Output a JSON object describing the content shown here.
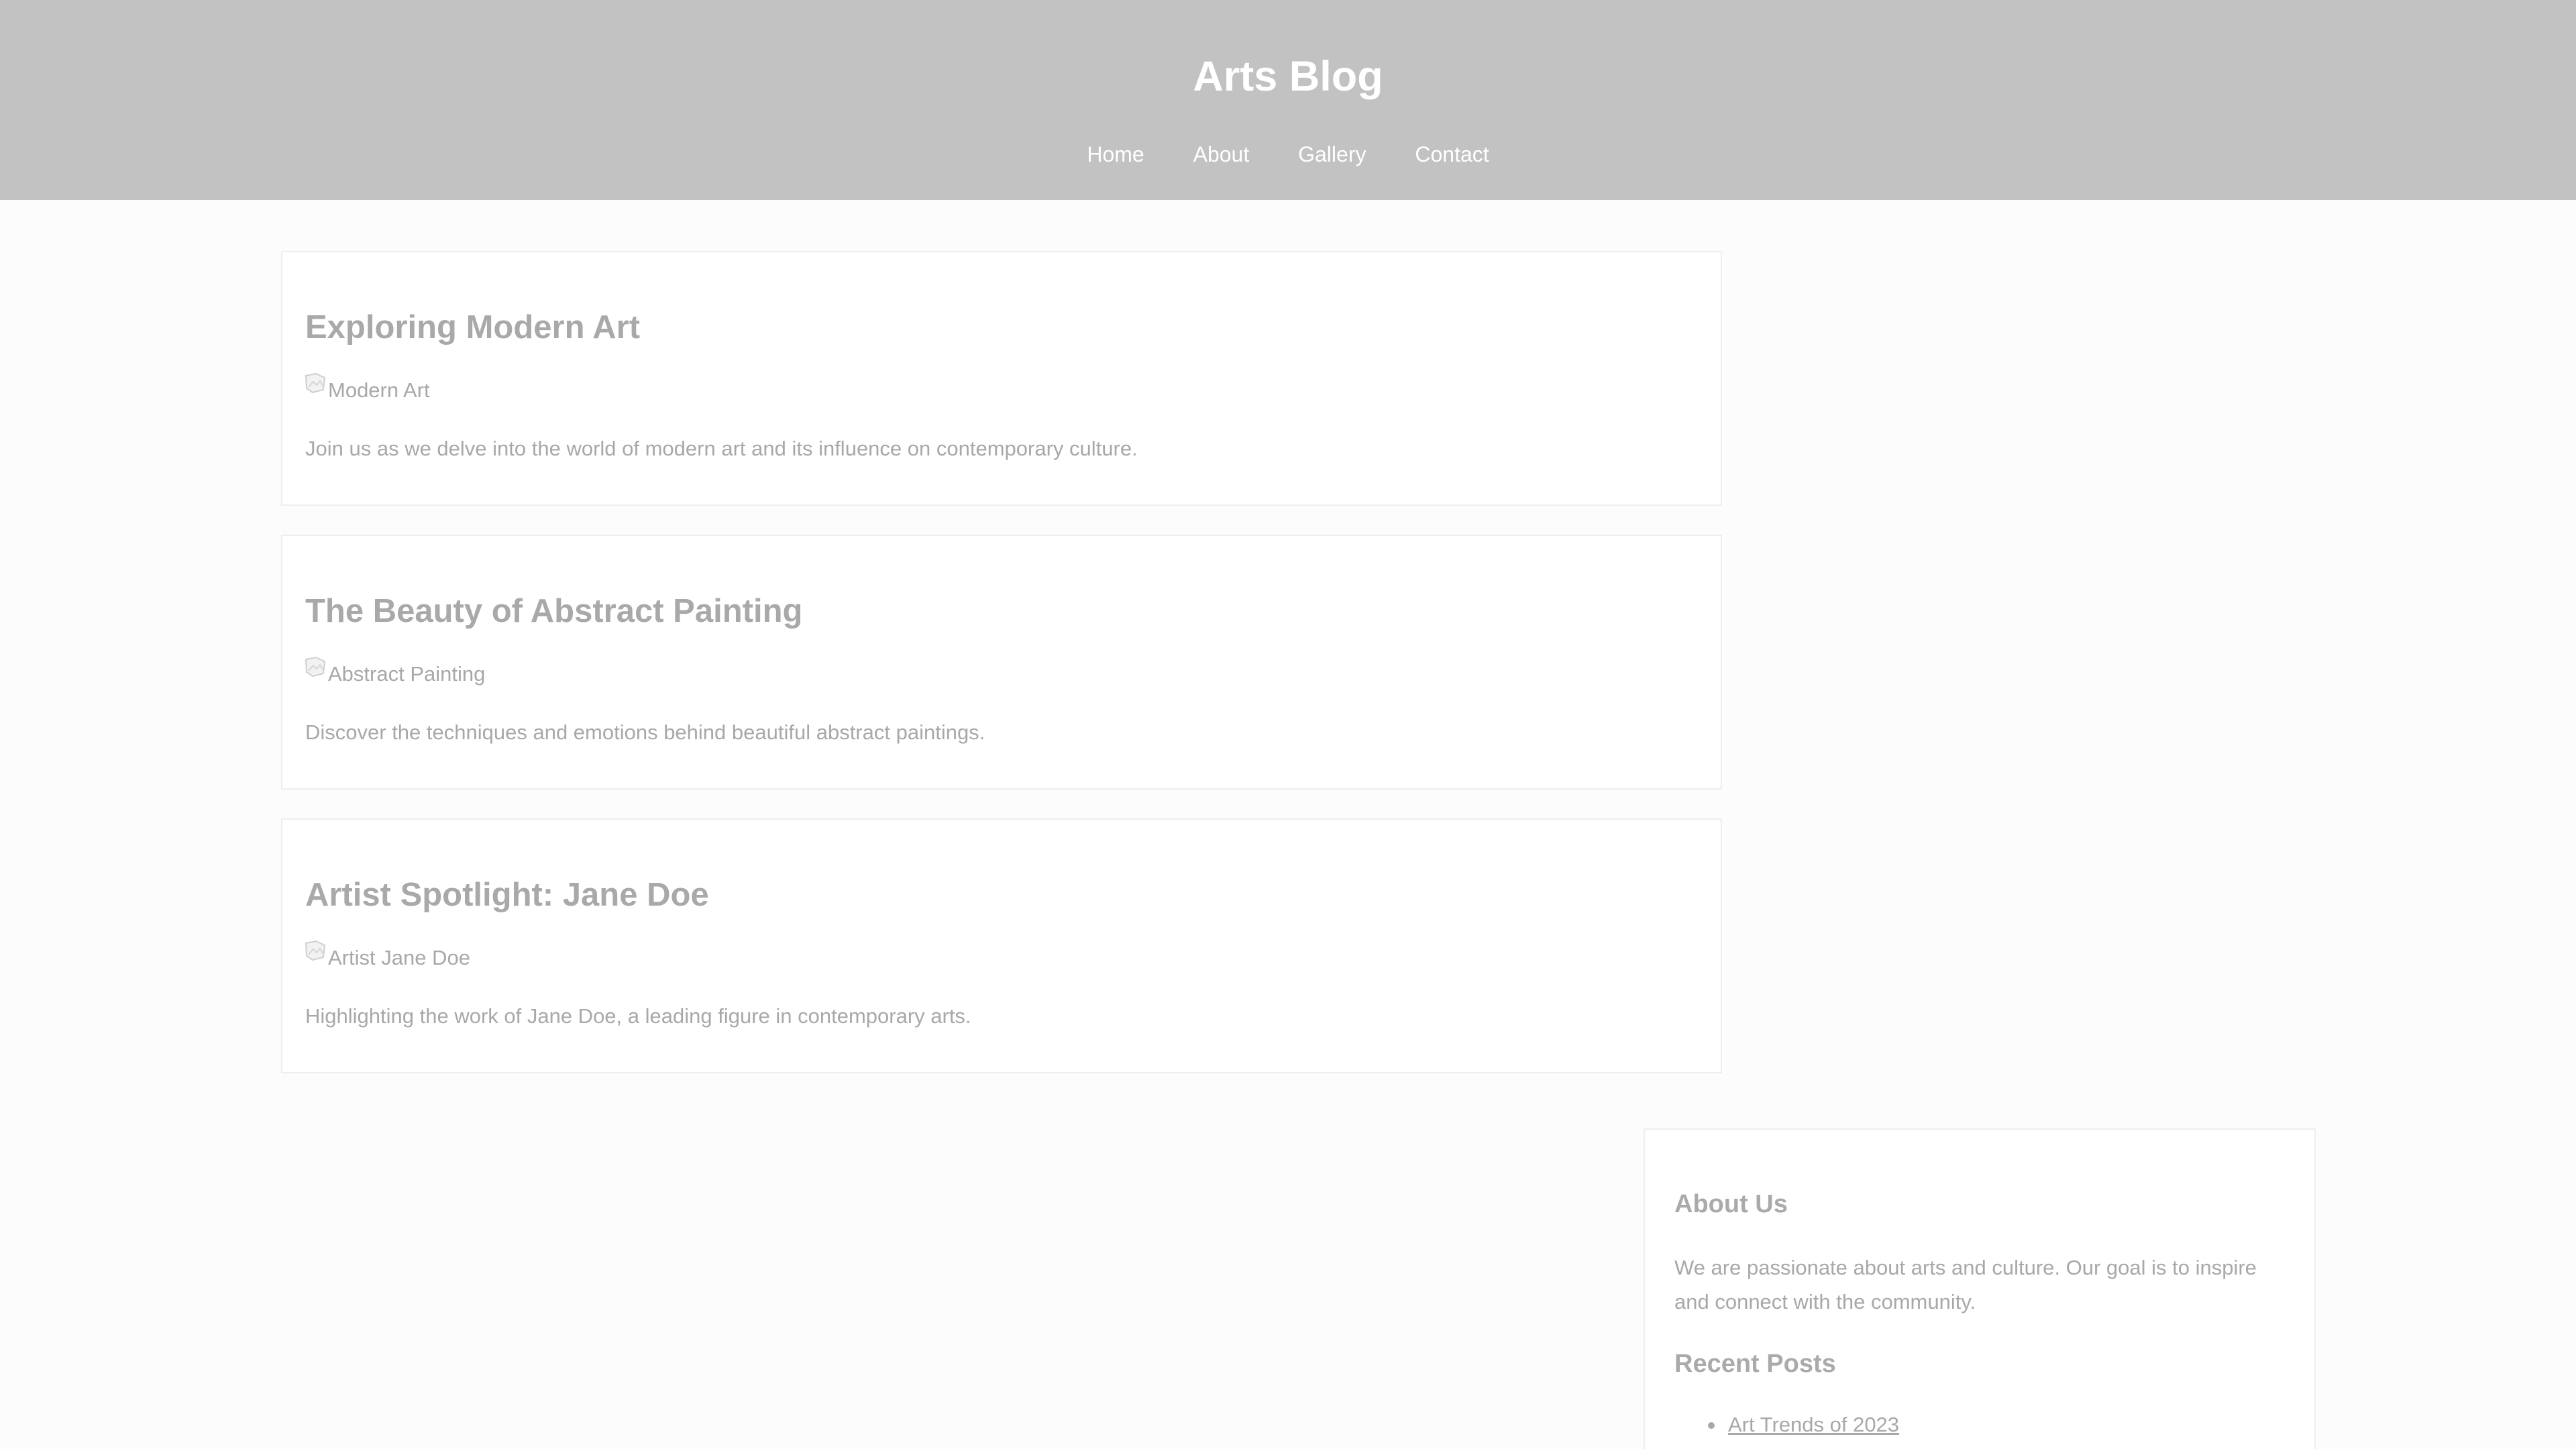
{
  "header": {
    "title": "Arts Blog",
    "nav": [
      "Home",
      "About",
      "Gallery",
      "Contact"
    ]
  },
  "posts": [
    {
      "title": "Exploring Modern Art",
      "image_alt": "Modern Art",
      "excerpt": "Join us as we delve into the world of modern art and its influence on contemporary culture."
    },
    {
      "title": "The Beauty of Abstract Painting",
      "image_alt": "Abstract Painting",
      "excerpt": "Discover the techniques and emotions behind beautiful abstract paintings."
    },
    {
      "title": "Artist Spotlight: Jane Doe",
      "image_alt": "Artist Jane Doe",
      "excerpt": "Highlighting the work of Jane Doe, a leading figure in contemporary arts."
    }
  ],
  "sidebar": {
    "about_title": "About Us",
    "about_text": "We are passionate about arts and culture. Our goal is to inspire and connect with the community.",
    "recent_title": "Recent Posts",
    "recent_posts": [
      "Art Trends of 2023"
    ]
  },
  "icons": {
    "broken_image": "broken-image-icon",
    "bullet": "bullet-icon"
  },
  "colors": {
    "header_bg": "#c2c2c2",
    "header_text": "#ffffff",
    "page_bg": "#fcfcfc",
    "card_bg": "#ffffff",
    "text_muted": "#a8a8a8"
  }
}
